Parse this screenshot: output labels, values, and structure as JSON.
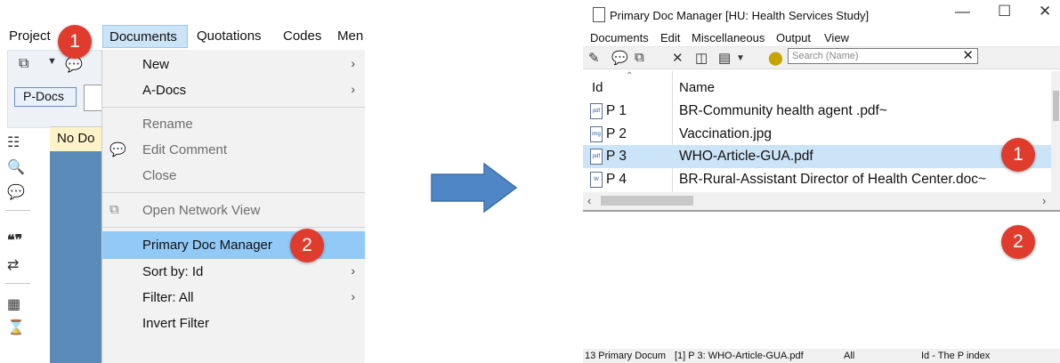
{
  "left": {
    "menubar": [
      "Project",
      "Documents",
      "Quotations",
      "Codes",
      "Men"
    ],
    "pdocs_label": "P-Docs",
    "nodoc_label": "No Do",
    "dropdown": [
      {
        "label": "New",
        "arrow": true,
        "disabled": false
      },
      {
        "label": "A-Docs",
        "arrow": true,
        "disabled": false
      },
      {
        "label": "Rename",
        "arrow": false,
        "disabled": true
      },
      {
        "label": "Edit Comment",
        "arrow": false,
        "disabled": true
      },
      {
        "label": "Close",
        "arrow": false,
        "disabled": true
      },
      {
        "label": "Open Network View",
        "arrow": false,
        "disabled": true
      },
      {
        "label": "Primary Doc Manager",
        "arrow": false,
        "disabled": false,
        "highlighted": true
      },
      {
        "label": "Sort by: Id",
        "arrow": true,
        "disabled": false
      },
      {
        "label": "Filter: All",
        "arrow": true,
        "disabled": false
      },
      {
        "label": "Invert Filter",
        "arrow": false,
        "disabled": false
      }
    ],
    "badge1": "1",
    "badge2": "2"
  },
  "window": {
    "title": "Primary Doc Manager [HU: Health Services Study]",
    "menu": [
      "Documents",
      "Edit",
      "Miscellaneous",
      "Output",
      "View"
    ],
    "search_placeholder": "Search (Name)",
    "columns": {
      "id": "Id",
      "name": "Name"
    },
    "rows": [
      {
        "id": "P 1",
        "name": "BR-Community health agent .pdf~",
        "type": "pdf",
        "selected": false
      },
      {
        "id": "P 2",
        "name": "Vaccination.jpg",
        "type": "img",
        "selected": false
      },
      {
        "id": "P 3",
        "name": "WHO-Article-GUA.pdf",
        "type": "pdf",
        "selected": true
      },
      {
        "id": "P 4",
        "name": "BR-Rural-Assistant Director of Health Center.doc~",
        "type": "doc",
        "selected": false
      }
    ],
    "badge1": "1",
    "badge2": "2",
    "status": [
      "13 Primary Docum",
      "[1] P 3: WHO-Article-GUA.pdf",
      "All",
      "Id - The P index"
    ]
  },
  "colors": {
    "accent_red": "#e03c2e",
    "arrow_blue": "#4f86c6",
    "highlight": "#91c9f7"
  }
}
